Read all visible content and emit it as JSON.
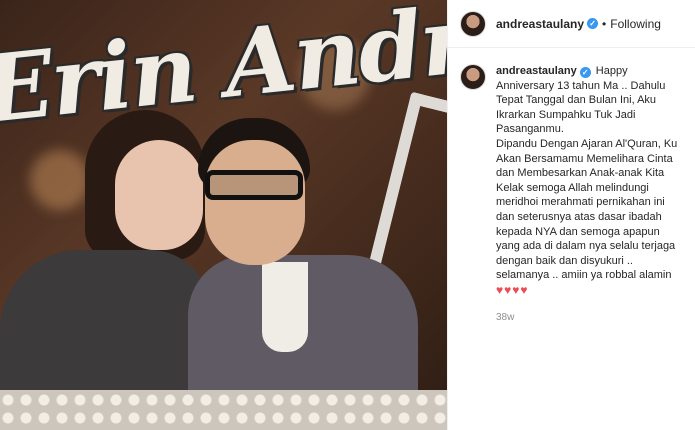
{
  "photo": {
    "sign_text": "Erin Andre"
  },
  "post": {
    "username": "andreastaulany",
    "verified_icon": "verified-badge-icon",
    "separator": "•",
    "follow_label": "Following"
  },
  "caption": {
    "username": "andreastaulany",
    "lines": [
      "Happy Anniversary 13 tahun Ma .. Dahulu Tepat Tanggal dan Bulan Ini, Aku Ikrarkan Sumpahku Tuk Jadi Pasanganmu.",
      "Dipandu Dengan Ajaran Al'Quran, Ku Akan Bersamamu Memelihara Cinta dan Membesarkan Anak-anak Kita",
      "Kelak semoga Allah melindungi meridhoi merahmati pernikahan ini dan seterusnya atas dasar ibadah kepada NYA dan semoga apapun yang ada di dalam nya selalu terjaga dengan baik dan disyukuri ..",
      "selamanya .. amiin ya robbal alamin"
    ],
    "hearts": "♥♥♥♥"
  },
  "timestamp": "38w",
  "colors": {
    "verified": "#3897f0",
    "heart": "#ed4956",
    "muted": "#8e8e8e"
  }
}
